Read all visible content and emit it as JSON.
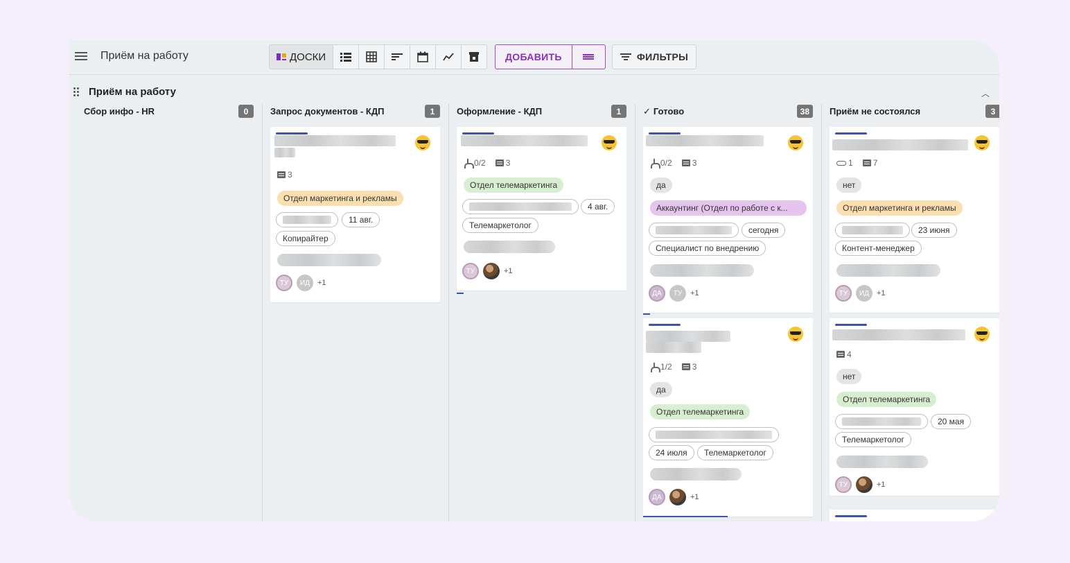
{
  "app": {
    "title": "Приём на работу"
  },
  "toolbar": {
    "views": [
      {
        "label": "ДОСКИ",
        "icon": "board-icon",
        "active": true
      },
      {
        "icon": "list-icon"
      },
      {
        "icon": "table-icon"
      },
      {
        "icon": "sort-icon"
      },
      {
        "icon": "calendar-icon"
      },
      {
        "icon": "chart-icon"
      },
      {
        "icon": "archive-icon"
      }
    ],
    "add_label": "ДОБАВИТЬ",
    "filters_label": "ФИЛЬТРЫ"
  },
  "group": {
    "title": "Приём на работу"
  },
  "columns": [
    {
      "title": "Сбор инфо - HR",
      "count": "0"
    },
    {
      "title": "Запрос документов - КДП",
      "count": "1"
    },
    {
      "title": "Оформление - КДП",
      "count": "1"
    },
    {
      "title": "Готово",
      "count": "38"
    },
    {
      "title": "Приём не состоялся",
      "count": "3"
    }
  ],
  "cards": {
    "c1": {
      "comments": "3",
      "dept": "Отдел маркетинга и рекламы",
      "date": "11 авг.",
      "role": "Копирайтер",
      "av1": "ТУ",
      "av2": "ИД",
      "more": "+1"
    },
    "c2": {
      "subtasks": "0/2",
      "comments": "3",
      "dept": "Отдел телемаркетинга",
      "date": "4 авг.",
      "role": "Телемаркетолог",
      "av1": "ТУ",
      "more": "+1"
    },
    "c3": {
      "subtasks": "0/2",
      "comments": "3",
      "answer": "да",
      "dept": "Аккаунтинг (Отдел по работе с к...",
      "date": "сегодня",
      "role": "Специалист по внедрению",
      "av1": "ДА",
      "av2": "ТУ",
      "more": "+1"
    },
    "c4": {
      "subtasks": "1/2",
      "comments": "3",
      "answer": "да",
      "dept": "Отдел телемаркетинга",
      "date": "24 июля",
      "role": "Телемаркетолог",
      "av1": "ДА",
      "more": "+1"
    },
    "c5": {
      "attachments": "1",
      "comments": "7",
      "answer": "нет",
      "dept": "Отдел маркетинга и рекламы",
      "date": "23 июня",
      "role": "Контент-менеджер",
      "av1": "ТУ",
      "av2": "ИД",
      "more": "+1"
    },
    "c6": {
      "comments": "4",
      "answer": "нет",
      "dept": "Отдел телемаркетинга",
      "date": "20 мая",
      "role": "Телемаркетолог",
      "av1": "ТУ",
      "more": "+1"
    }
  }
}
